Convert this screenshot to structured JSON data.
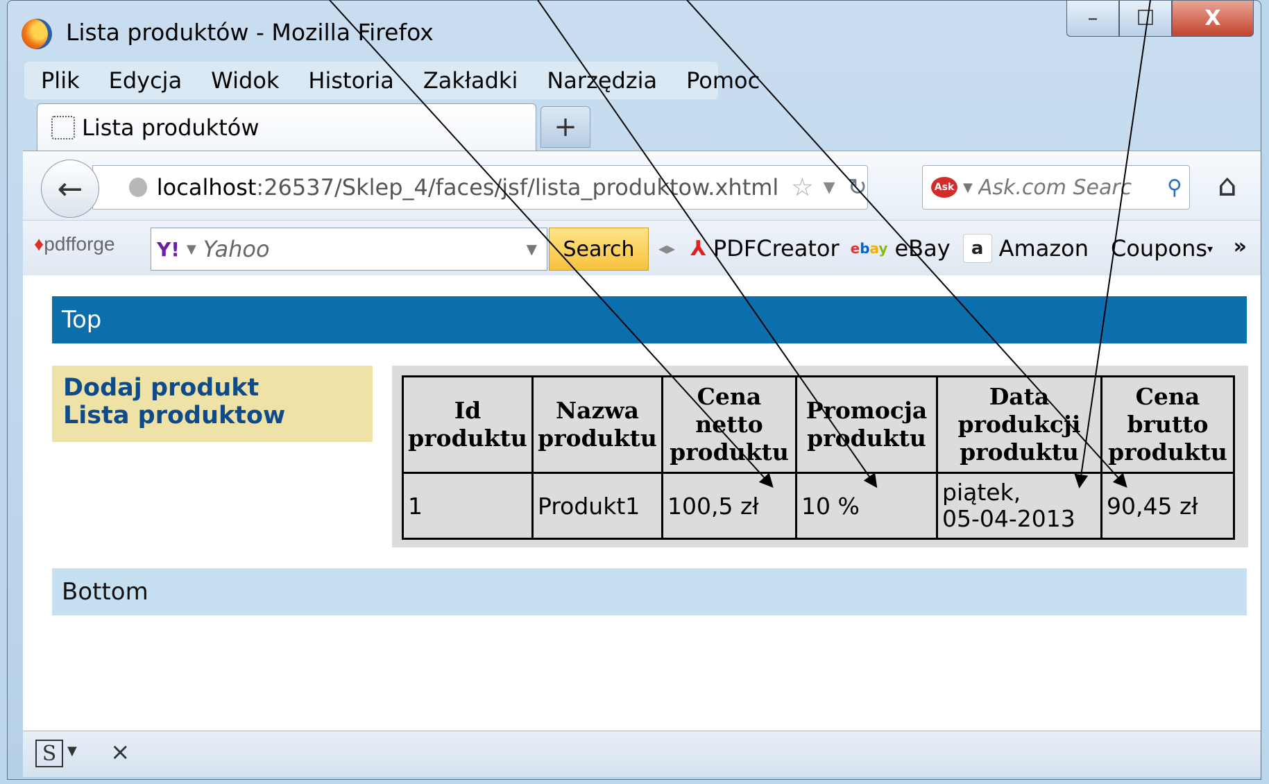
{
  "window": {
    "title": "Lista produktów - Mozilla Firefox",
    "controls": {
      "minimize": "–",
      "maximize": "☐",
      "close": "X"
    }
  },
  "menubar": [
    "Plik",
    "Edycja",
    "Widok",
    "Historia",
    "Zakładki",
    "Narzędzia",
    "Pomoc"
  ],
  "tabs": [
    {
      "label": "Lista produktów"
    }
  ],
  "new_tab_label": "+",
  "navbar": {
    "url_host": "localhost",
    "url_path": ":26537/Sklep_4/faces/jsf/lista_produktow.xhtml",
    "search_placeholder": "Ask.com Searc"
  },
  "toolbar": {
    "pdfforge_logo": "pdfforge",
    "yahoo_text": "Yahoo",
    "search_button": "Search",
    "items": [
      "PDFCreator",
      "eBay",
      "Amazon",
      "Coupons"
    ],
    "overflow": "»"
  },
  "page": {
    "top_band": "Top",
    "bottom_band": "Bottom",
    "menu_links": [
      "Dodaj produkt",
      "Lista produktow"
    ],
    "table": {
      "headers": [
        [
          "Id",
          "produktu"
        ],
        [
          "Nazwa",
          "produktu"
        ],
        [
          "Cena",
          "netto",
          "produktu"
        ],
        [
          "Promocja",
          "produktu"
        ],
        [
          "Data",
          "produkcji",
          "produktu"
        ],
        [
          "Cena",
          "brutto",
          "produktu"
        ]
      ],
      "rows": [
        [
          "1",
          "Produkt1",
          "100,5 zł",
          "10 %",
          "piątek,",
          "90,45 zł"
        ]
      ],
      "date_second_line": "05-04-2013"
    }
  },
  "statusbar": {
    "s_icon": "S",
    "close": "×"
  },
  "icons": {
    "back": "back-arrow-icon",
    "home": "home-icon",
    "reload": "reload-icon",
    "star": "bookmark-star-icon",
    "ask": "ask-logo-icon",
    "magnifier": "search-icon",
    "yahoo": "yahoo-icon",
    "pdf": "pdf-icon",
    "ebay": "ebay-icon",
    "amazon": "amazon-icon"
  },
  "colors": {
    "top_band": "#0b6fae",
    "bottom_band": "#c7e0f1",
    "side_menu": "#efe2a6",
    "table_bg": "#dcdcdc",
    "link": "#0d4b8a"
  }
}
